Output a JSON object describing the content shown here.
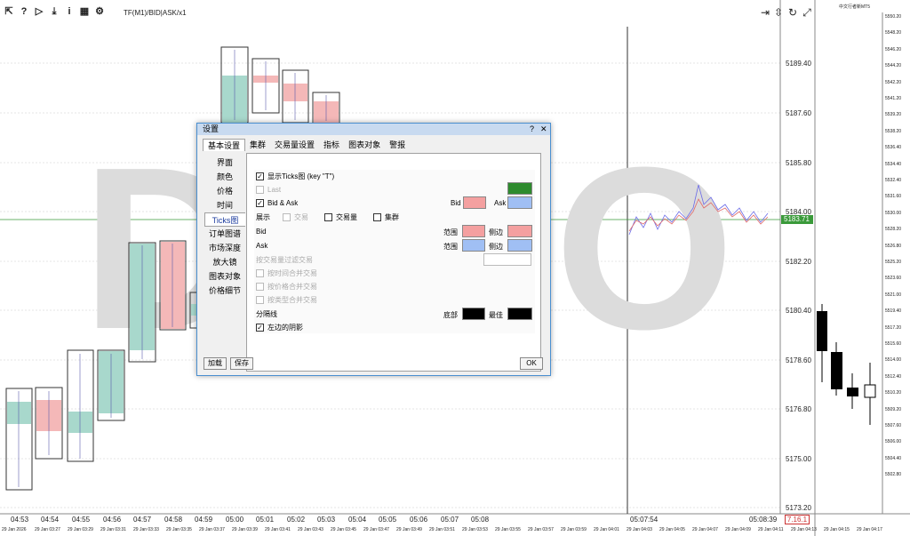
{
  "toolbar": {
    "icons": [
      "arrow-cursor-icon",
      "help-icon",
      "play-icon",
      "download-icon",
      "info-icon",
      "chart-icon",
      "gear-icon"
    ],
    "labels": [
      "⇱",
      "?",
      "▷",
      "⤓",
      "i",
      "▦",
      "⚙"
    ],
    "tf_text": "TF(M1)/BID|ASK/x1"
  },
  "right_toolbar": {
    "labels": [
      "⇥",
      "⇳",
      "↻",
      "⤢"
    ],
    "icons": [
      "scroll-end-icon",
      "scale-icon",
      "refresh-icon",
      "expand-icon"
    ]
  },
  "watermark": {
    "left": "D",
    "right": "O"
  },
  "price_axis": {
    "labels": [
      "5189.40",
      "5187.60",
      "5185.80",
      "5184.00",
      "5182.20",
      "5180.40",
      "5178.60",
      "5176.80",
      "5175.00",
      "5173.20"
    ],
    "current": "5183.71"
  },
  "time_axis": {
    "labels": [
      "04:53",
      "04:54",
      "04:55",
      "04:56",
      "04:57",
      "04:58",
      "04:59",
      "05:00",
      "05:01",
      "05:02",
      "05:03",
      "05:04",
      "05:05",
      "05:06",
      "05:07",
      "05:08"
    ],
    "cursor_time": "05:07:54",
    "end_time": "05:08:39",
    "multiplier": "7.16.1"
  },
  "date_axis": {
    "labels": [
      "29 Jan 2026",
      "29 Jan 03:27",
      "29 Jan 03:29",
      "29 Jan 03:31",
      "29 Jan 03:33",
      "29 Jan 03:35",
      "29 Jan 03:37",
      "29 Jan 03:39",
      "29 Jan 03:41",
      "29 Jan 03:43",
      "29 Jan 03:45",
      "29 Jan 03:47",
      "29 Jan 03:49",
      "29 Jan 03:51",
      "29 Jan 03:53",
      "29 Jan 03:55",
      "29 Jan 03:57",
      "29 Jan 03:59",
      "29 Jan 04:01",
      "29 Jan 04:03",
      "29 Jan 04:05",
      "29 Jan 04:07",
      "29 Jan 04:09",
      "29 Jan 04:11",
      "29 Jan 04:13",
      "29 Jan 04:15",
      "29 Jan 04:17"
    ]
  },
  "right_panel": {
    "title": "中文行者新MT5",
    "prices": [
      "5550.20",
      "5548.20",
      "5546.20",
      "5544.20",
      "5542.20",
      "5541.20",
      "5539.20",
      "5538.20",
      "5536.40",
      "5534.40",
      "5532.40",
      "5531.60",
      "5530.00",
      "5528.20",
      "5526.80",
      "5525.20",
      "5523.60",
      "5521.00",
      "5519.40",
      "5517.20",
      "5515.60",
      "5514.00",
      "5512.40",
      "5510.20",
      "5509.20",
      "5507.60",
      "5506.00",
      "5504.40",
      "5502.80"
    ]
  },
  "dialog": {
    "title": "设置",
    "help": "?",
    "close": "✕",
    "tabs": [
      "基本设置",
      "集群",
      "交易量设置",
      "指标",
      "图表对象",
      "警报"
    ],
    "side": [
      "界面",
      "颜色",
      "价格",
      "时间",
      "Ticks图",
      "订单图谱",
      "市场深度",
      "放大镜",
      "图表对象",
      "价格细节"
    ],
    "show_ticks": "显示Ticks图 (key \"T\")",
    "last": "Last",
    "bid_ask": "Bid & Ask",
    "bid_label": "Bid",
    "ask_label": "Ask",
    "show_label": "展示",
    "trade_label": "交易",
    "volume_label": "交易量",
    "cluster_label": "集群",
    "bid_row": "Bid",
    "ask_row": "Ask",
    "range_label": "范围",
    "side_label": "侧边",
    "filter_label": "按交易量过滤交易",
    "merge_time": "按时间合并交易",
    "merge_price": "按价格合并交易",
    "merge_type": "按类型合并交易",
    "separator": "分隔线",
    "bottom_label": "底部",
    "best_label": "最佳",
    "left_shadow": "左边的阴影",
    "load": "加载",
    "save": "保存",
    "ok": "OK"
  },
  "colors": {
    "accent": "#4a8fd0",
    "bid": "#f4a0a0",
    "ask": "#a0bff4",
    "green": "#2e8b2e",
    "current_line": "#3a9a3a"
  }
}
